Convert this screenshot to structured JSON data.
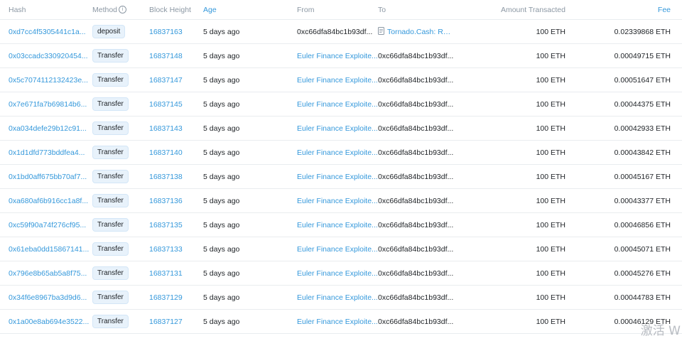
{
  "table": {
    "headers": {
      "hash": "Hash",
      "method": "Method",
      "block": "Block Height",
      "age": "Age",
      "from": "From",
      "to": "To",
      "amount": "Amount Transacted",
      "fee": "Fee"
    },
    "rows": [
      {
        "hash": "0xd7cc4f5305441c1a...",
        "method": "deposit",
        "block": "16837163",
        "age": "5 days ago",
        "from": "0xc66dfa84bc1b93df...",
        "to": "Tornado.Cash: Rou...",
        "to_is_contract": true,
        "amount": "100 ETH",
        "fee": "0.02339868 ETH"
      },
      {
        "hash": "0x03ccadc330920454...",
        "method": "Transfer",
        "block": "16837148",
        "age": "5 days ago",
        "from": "Euler Finance Exploite...",
        "to": "0xc66dfa84bc1b93df...",
        "to_is_contract": false,
        "amount": "100 ETH",
        "fee": "0.00049715 ETH"
      },
      {
        "hash": "0x5c7074112132423e...",
        "method": "Transfer",
        "block": "16837147",
        "age": "5 days ago",
        "from": "Euler Finance Exploite...",
        "to": "0xc66dfa84bc1b93df...",
        "to_is_contract": false,
        "amount": "100 ETH",
        "fee": "0.00051647 ETH"
      },
      {
        "hash": "0x7e671fa7b69814b6...",
        "method": "Transfer",
        "block": "16837145",
        "age": "5 days ago",
        "from": "Euler Finance Exploite...",
        "to": "0xc66dfa84bc1b93df...",
        "to_is_contract": false,
        "amount": "100 ETH",
        "fee": "0.00044375 ETH"
      },
      {
        "hash": "0xa034defe29b12c91...",
        "method": "Transfer",
        "block": "16837143",
        "age": "5 days ago",
        "from": "Euler Finance Exploite...",
        "to": "0xc66dfa84bc1b93df...",
        "to_is_contract": false,
        "amount": "100 ETH",
        "fee": "0.00042933 ETH"
      },
      {
        "hash": "0x1d1dfd773bddfea4...",
        "method": "Transfer",
        "block": "16837140",
        "age": "5 days ago",
        "from": "Euler Finance Exploite...",
        "to": "0xc66dfa84bc1b93df...",
        "to_is_contract": false,
        "amount": "100 ETH",
        "fee": "0.00043842 ETH"
      },
      {
        "hash": "0x1bd0aff675bb70af7...",
        "method": "Transfer",
        "block": "16837138",
        "age": "5 days ago",
        "from": "Euler Finance Exploite...",
        "to": "0xc66dfa84bc1b93df...",
        "to_is_contract": false,
        "amount": "100 ETH",
        "fee": "0.00045167 ETH"
      },
      {
        "hash": "0xa680af6b916cc1a8f...",
        "method": "Transfer",
        "block": "16837136",
        "age": "5 days ago",
        "from": "Euler Finance Exploite...",
        "to": "0xc66dfa84bc1b93df...",
        "to_is_contract": false,
        "amount": "100 ETH",
        "fee": "0.00043377 ETH"
      },
      {
        "hash": "0xc59f90a74f276cf95...",
        "method": "Transfer",
        "block": "16837135",
        "age": "5 days ago",
        "from": "Euler Finance Exploite...",
        "to": "0xc66dfa84bc1b93df...",
        "to_is_contract": false,
        "amount": "100 ETH",
        "fee": "0.00046856 ETH"
      },
      {
        "hash": "0x61eba0dd15867141...",
        "method": "Transfer",
        "block": "16837133",
        "age": "5 days ago",
        "from": "Euler Finance Exploite...",
        "to": "0xc66dfa84bc1b93df...",
        "to_is_contract": false,
        "amount": "100 ETH",
        "fee": "0.00045071 ETH"
      },
      {
        "hash": "0x796e8b65ab5a8f75...",
        "method": "Transfer",
        "block": "16837131",
        "age": "5 days ago",
        "from": "Euler Finance Exploite...",
        "to": "0xc66dfa84bc1b93df...",
        "to_is_contract": false,
        "amount": "100 ETH",
        "fee": "0.00045276 ETH"
      },
      {
        "hash": "0x34f6e8967ba3d9d6...",
        "method": "Transfer",
        "block": "16837129",
        "age": "5 days ago",
        "from": "Euler Finance Exploite...",
        "to": "0xc66dfa84bc1b93df...",
        "to_is_contract": false,
        "amount": "100 ETH",
        "fee": "0.00044783 ETH"
      },
      {
        "hash": "0x1a00e8ab694e3522...",
        "method": "Transfer",
        "block": "16837127",
        "age": "5 days ago",
        "from": "Euler Finance Exploite...",
        "to": "0xc66dfa84bc1b93df...",
        "to_is_contract": false,
        "amount": "100 ETH",
        "fee": "0.00046129 ETH"
      }
    ]
  },
  "watermark": "激活 W",
  "colors": {
    "link": "#3498db",
    "header_text": "#8c98a4",
    "badge_bg": "#e8f2fb",
    "border": "#e9ecef"
  }
}
